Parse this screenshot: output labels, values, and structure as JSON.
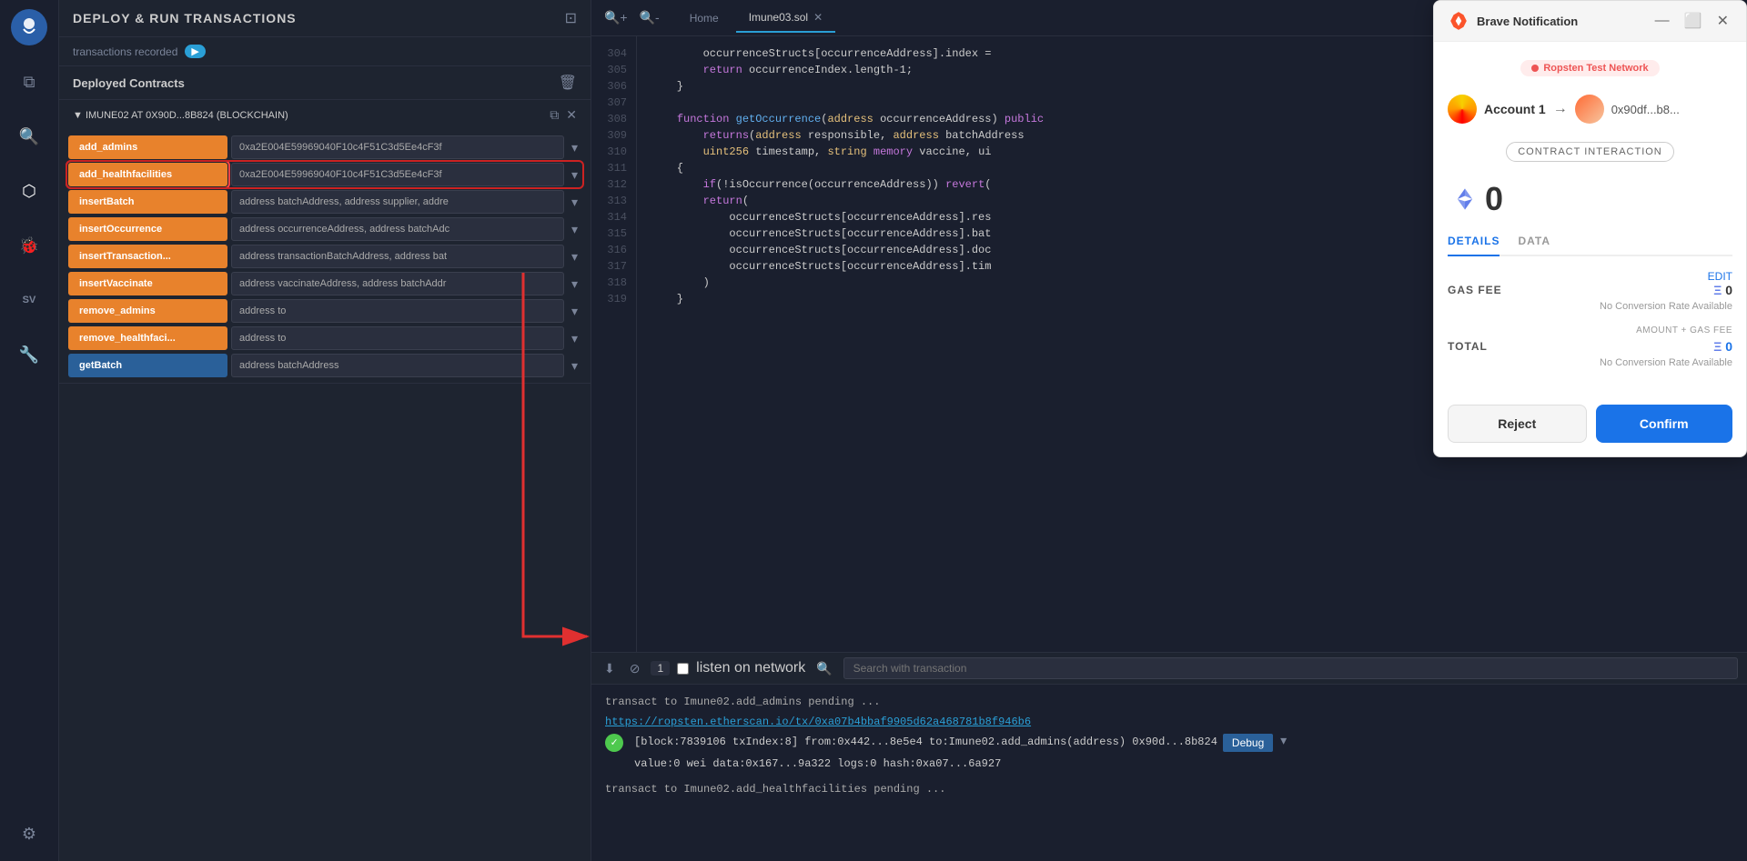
{
  "app": {
    "title": "DEPLOY & RUN TRANSACTIONS"
  },
  "sidebar": {
    "icons": [
      "☁",
      "⧉",
      "⚙",
      "✓",
      "◈",
      "SV",
      "🔧"
    ]
  },
  "deploy_panel": {
    "title": "DEPLOY & RUN TRANSACTIONS",
    "transactions_label": "transactions recorded",
    "tx_count": "▶",
    "deployed_contracts_label": "Deployed Contracts",
    "contract_instance": {
      "label": "▼  IMUNE02 AT 0X90D...8B824 (BLOCKCHAIN)"
    },
    "functions": [
      {
        "name": "add_admins",
        "input": "0xa2E004E59969040F10c4F51C3d5Ee4cF3f",
        "type": "write",
        "active": false
      },
      {
        "name": "add_healthfacilities",
        "input": "0xa2E004E59969040F10c4F51C3d5Ee4cF3f",
        "type": "write",
        "active": true
      },
      {
        "name": "insertBatch",
        "input": "address batchAddress, address supplier, addre",
        "type": "write",
        "active": false
      },
      {
        "name": "insertOccurrence",
        "input": "address occurrenceAddress, address batchAdc",
        "type": "write",
        "active": false
      },
      {
        "name": "insertTransaction...",
        "input": "address transactionBatchAddress, address bat",
        "type": "write",
        "active": false
      },
      {
        "name": "insertVaccinate",
        "input": "address vaccinateAddress, address batchAddr",
        "type": "write",
        "active": false
      },
      {
        "name": "remove_admins",
        "input": "address to",
        "type": "write",
        "active": false
      },
      {
        "name": "remove_healthfaci...",
        "input": "address to",
        "type": "write",
        "active": false
      },
      {
        "name": "getBatch",
        "input": "address batchAddress",
        "type": "view",
        "active": false
      }
    ]
  },
  "editor": {
    "home_tab": "Home",
    "file_tab": "Imune03.sol",
    "lines": [
      304,
      305,
      306,
      307,
      308,
      309,
      310,
      311,
      312,
      313,
      314,
      315,
      316,
      317,
      318,
      319
    ],
    "code": [
      "        occurrenceStructs[occurrenceAddress].index =",
      "        return occurrenceIndex.length-1;",
      "    }",
      "",
      "    function getOccurrence(address occurrenceAddress) public",
      "        returns(address responsible, address batchAddress",
      "        uint256 timestamp, string memory vaccine, ui",
      "    {",
      "        if(!isOccurrence(occurrenceAddress)) revert(",
      "        return(",
      "            occurrenceStructs[occurrenceAddress].res",
      "            occurrenceStructs[occurrenceAddress].bat",
      "            occurrenceStructs[occurrenceAddress].doc",
      "            occurrenceStructs[occurrenceAddress].tim",
      "        )",
      "    }"
    ]
  },
  "terminal": {
    "count": "1",
    "listen_label": "listen on network",
    "search_placeholder": "Search with transaction",
    "lines": [
      {
        "type": "pending",
        "text": "transact to Imune02.add_admins pending ..."
      },
      {
        "type": "link",
        "text": "https://ropsten.etherscan.io/tx/0xa07b4bbaf9905d62a468781b8f946b6"
      },
      {
        "type": "block",
        "block": "[block:7839106 txIndex:8]",
        "from": "from:0x442...8e5e4",
        "to": "to:Imune02.add_admins(address) 0x90d...8b824",
        "value": "value:0 wei data:0x167...9a322 logs:0 hash:0xa07...6a927"
      },
      {
        "type": "pending2",
        "text": "transact to Imune02.add_healthfacilities pending ..."
      }
    ],
    "debug_label": "Debug"
  },
  "brave_notification": {
    "title": "Brave Notification",
    "network": "Ropsten Test Network",
    "account_name": "Account 1",
    "account_address": "0x90df...b8...",
    "contract_interaction": "CONTRACT INTERACTION",
    "eth_amount": "0",
    "details_tab": "DETAILS",
    "data_tab": "DATA",
    "edit_label": "EDIT",
    "gas_fee_label": "GAS FEE",
    "gas_fee_value": "0",
    "no_conversion": "No Conversion Rate Available",
    "amount_gas_label": "AMOUNT + GAS FEE",
    "total_label": "TOTAL",
    "total_value": "0",
    "total_conversion": "No Conversion Rate Available",
    "reject_label": "Reject",
    "confirm_label": "Confirm"
  }
}
